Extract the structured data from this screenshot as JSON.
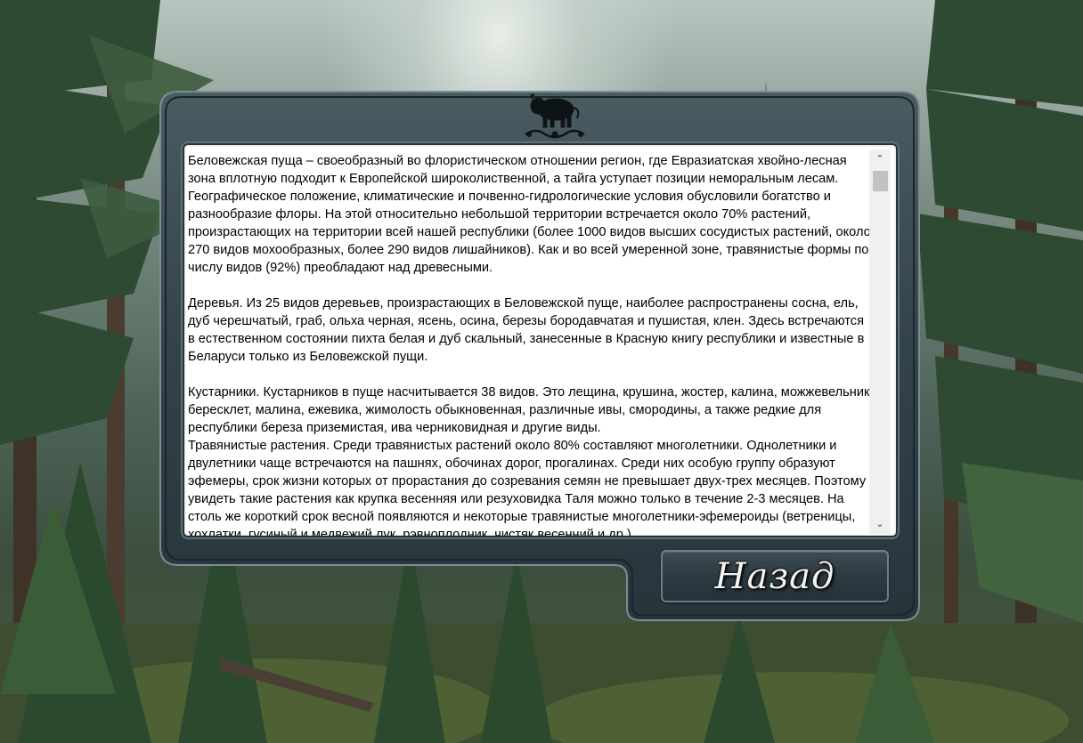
{
  "content": {
    "text": "Беловежская пуща – своеобразный во флористическом отношении регион, где Евразиатская хвойно-лесная зона вплотную подходит к Европейской широколиственной, а тайга уступает позиции неморальным лесам. Географическое положение, климатические и почвенно-гидрологические условия обусловили богатство и разнообразие флоры. На этой относительно небольшой территории встречается около 70% растений, произрастающих на территории всей нашей республики (более 1000 видов высших сосудистых растений, около 270 видов мохообразных, более 290 видов лишайников). Как и во всей умеренной зоне, травянистые формы по числу видов (92%) преобладают над древесными.\n\nДеревья. Из 25 видов деревьев, произрастающих в Беловежской пуще, наиболее распространены сосна, ель, дуб черешчатый, граб, ольха черная, ясень, осина, березы бородавчатая и пушистая, клен. Здесь встречаются в естественном состоянии пихта белая и дуб скальный, занесенные в Красную книгу республики и известные в Беларуси только из Беловежской пущи.\n\nКустарники. Кустарников в пуще насчитывается 38 видов. Это лещина, крушина, жостер, калина, можжевельник, бересклет, малина, ежевика, жимолость обыкновенная, различные ивы, смородины, а также редкие для республики береза приземистая, ива черниковидная и другие виды.\nТравянистые растения. Среди травянистых растений около 80% составляют многолетники. Однолетники и двулетники чаще встречаются на пашнях, обочинах дорог, прогалинах. Среди них особую группу образуют эфемеры, срок жизни которых от прорастания до созревания семян не превышает двух-трех месяцев. Поэтому увидеть такие растения как крупка весенняя или резуховидка Таля можно только в течение 2-3 месяцев. На столь же короткий срок весной появляются и некоторые травянистые многолетники-эфемероиды (ветреницы, хохлатки, гусиный и медвежий лук, рэвноплодник, чистяк весенний и др.)."
  },
  "scrollbar": {
    "up_icon": "chevron-up-icon",
    "down_icon": "chevron-down-icon",
    "up_glyph": "⌃",
    "down_glyph": "⌄"
  },
  "back_button": {
    "label": "Назад"
  },
  "colors": {
    "panel_frame": "#3c4a50",
    "panel_dark": "#1f2a2f",
    "text_bg": "#ffffff",
    "button_text": "#f3f3f3"
  }
}
